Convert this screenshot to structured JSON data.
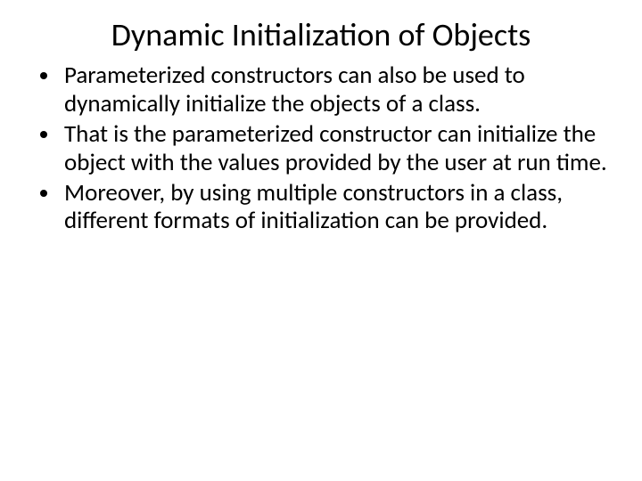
{
  "title": "Dynamic Initialization of Objects",
  "bullets": [
    "Parameterized constructors can also be used to dynamically initialize the objects of a class.",
    "That is the parameterized constructor can initialize the object with the values provided by the user at run time.",
    "Moreover, by using multiple constructors in a class, different formats of initialization can be provided."
  ]
}
